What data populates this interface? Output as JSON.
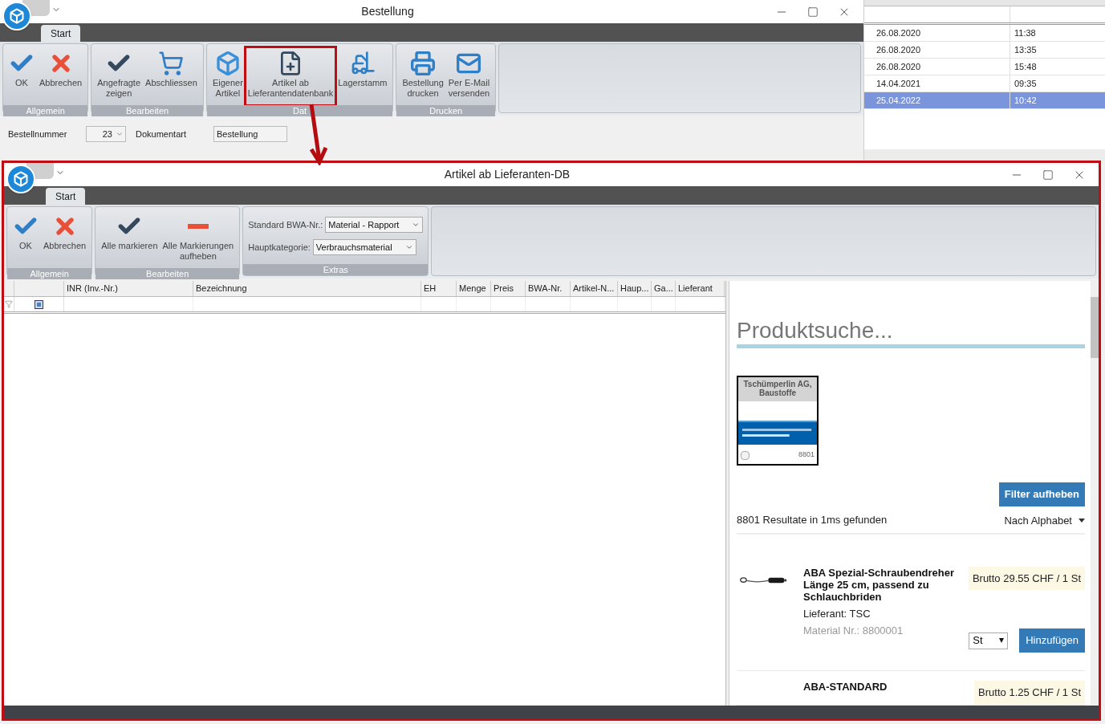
{
  "background_window": {
    "title": "Bestellung",
    "tab": "Start",
    "ribbon_groups": [
      {
        "label": "Allgemein",
        "buttons": [
          {
            "label": "OK",
            "kind": "check",
            "highlighted": false
          },
          {
            "label": "Abbrechen",
            "kind": "cross",
            "highlighted": false
          }
        ]
      },
      {
        "label": "Bearbeiten",
        "buttons": [
          {
            "label": "Angefragte\nzeigen",
            "kind": "dark-check",
            "highlighted": false
          },
          {
            "label": "Abschliessen",
            "kind": "cart",
            "highlighted": false
          }
        ]
      },
      {
        "label": "Dat",
        "buttons": [
          {
            "label": "Eigener\nArtikel",
            "kind": "cube",
            "highlighted": false
          },
          {
            "label": "Artikel ab\nLieferantendatenbank",
            "kind": "document",
            "highlighted": true
          },
          {
            "label": "Lagerstamm",
            "kind": "forklift",
            "highlighted": false
          }
        ]
      },
      {
        "label": "Drucken",
        "buttons": [
          {
            "label": "Bestellung\ndrucken",
            "kind": "printer",
            "highlighted": false
          },
          {
            "label": "Per E-Mail\nversenden",
            "kind": "mail",
            "highlighted": false
          }
        ]
      }
    ],
    "form_fields": [
      {
        "label": "Bestellnummer",
        "value": "23",
        "kind": "spinner"
      },
      {
        "label": "Dokumentart",
        "value": "Bestellung",
        "kind": "text"
      }
    ]
  },
  "order_list": {
    "rows": [
      {
        "date": "26.08.2020",
        "time": "11:38",
        "selected": false
      },
      {
        "date": "26.08.2020",
        "time": "13:35",
        "selected": false
      },
      {
        "date": "26.08.2020",
        "time": "15:48",
        "selected": false
      },
      {
        "date": "14.04.2021",
        "time": "09:35",
        "selected": false
      },
      {
        "date": "25.04.2022",
        "time": "10:42",
        "selected": true
      }
    ]
  },
  "dialog": {
    "title": "Artikel ab Lieferanten-DB",
    "tab": "Start",
    "ribbon_groups": [
      {
        "label": "Allgemein",
        "buttons": [
          {
            "label": "OK",
            "kind": "check"
          },
          {
            "label": "Abbrechen",
            "kind": "cross"
          }
        ]
      },
      {
        "label": "Bearbeiten",
        "buttons": [
          {
            "label": "Alle markieren",
            "kind": "dark-check"
          },
          {
            "label": "Alle Markierungen\naufheben",
            "kind": "minus"
          }
        ]
      },
      {
        "label": "Extras",
        "dropdowns": [
          {
            "label": "Standard BWA-Nr.:",
            "value": "Material - Rapport"
          },
          {
            "label": "Hauptkategorie:",
            "value": "Verbrauchsmaterial"
          }
        ]
      }
    ],
    "grid": {
      "columns": [
        "INR (Inv.-Nr.)",
        "Bezeichnung",
        "EH",
        "Menge",
        "Preis",
        "BWA-Nr.",
        "Artikel-N...",
        "Haup...",
        "Ga...",
        "Lieferant"
      ]
    },
    "search": {
      "placeholder": "Produktsuche..."
    },
    "supplier_filter": {
      "name": "Tschümperlin AG, Baustoffe",
      "checked": false,
      "count": "8801"
    },
    "clear_filter_button": "Filter aufheben",
    "results": "8801 Resultate in 1ms gefunden",
    "sort": "Nach Alphabet",
    "products": [
      {
        "name": "ABA Spezial-Schraubendreher Länge 25 cm, passend zu Schlauchbriden",
        "supplier": "Lieferant: TSC",
        "material": "Material Nr.: 8800001",
        "price": "Brutto 29.55 CHF / 1 St",
        "unit": "St",
        "add_button": "Hinzufügen"
      },
      {
        "name": "ABA-STANDARD",
        "price": "Brutto 1.25 CHF / 1 St"
      }
    ]
  }
}
